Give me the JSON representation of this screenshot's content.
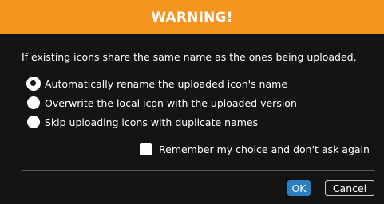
{
  "dialog": {
    "title": "WARNING!",
    "message": "If existing icons share the same name as the ones being uploaded,",
    "options": [
      {
        "label": "Automatically rename the uploaded icon's name",
        "selected": true
      },
      {
        "label": "Overwrite the local icon with the uploaded version",
        "selected": false
      },
      {
        "label": "Skip uploading icons with duplicate names",
        "selected": false
      }
    ],
    "remember_label": "Remember my choice and don't ask again",
    "remember_checked": false,
    "ok_label": "OK",
    "cancel_label": "Cancel"
  },
  "colors": {
    "titlebar": "#f5941e",
    "background": "#141414",
    "ok_button": "#2a7fc0"
  }
}
